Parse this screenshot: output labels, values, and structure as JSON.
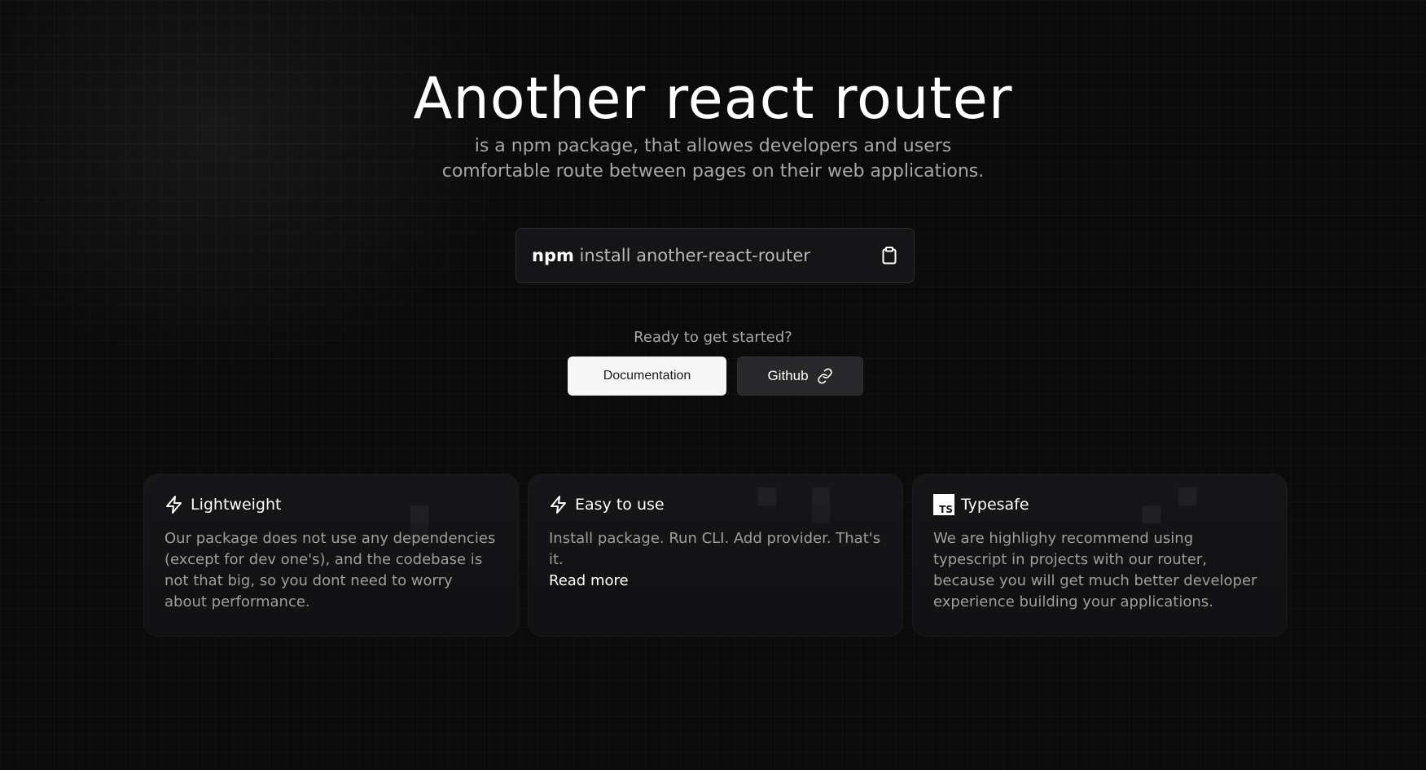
{
  "hero": {
    "title": "Another react router",
    "subtitle_line1": "is a npm package, that allowes developers and users",
    "subtitle_line2": "comfortable route between pages on their web applications."
  },
  "install": {
    "command_prefix": "npm",
    "command_rest": " install another-react-router",
    "copy_icon": "clipboard-icon"
  },
  "cta": {
    "prompt": "Ready to get started?",
    "documentation_label": "Documentation",
    "github_label": "Github",
    "github_icon": "link-icon"
  },
  "features": [
    {
      "icon": "lightning-icon",
      "title": "Lightweight",
      "body": "Our package does not use any dependencies (except for dev one's), and the codebase is not that big, so you dont need to worry about performance."
    },
    {
      "icon": "lightning-icon",
      "title": "Easy to use",
      "body": "Install package. Run CLI. Add provider. That's it.",
      "link": "Read more"
    },
    {
      "icon": "typescript-icon",
      "icon_text": "TS",
      "title": "Typesafe",
      "body": "We are highlighy recommend using typescript in projects with our router, because you will get much better developer experience building your applications."
    }
  ],
  "colors": {
    "background": "#0b0b0c",
    "card": "#151517",
    "text_muted": "#9e9e9e",
    "primary_button": "#f6f6f6",
    "secondary_button": "#28282b"
  }
}
